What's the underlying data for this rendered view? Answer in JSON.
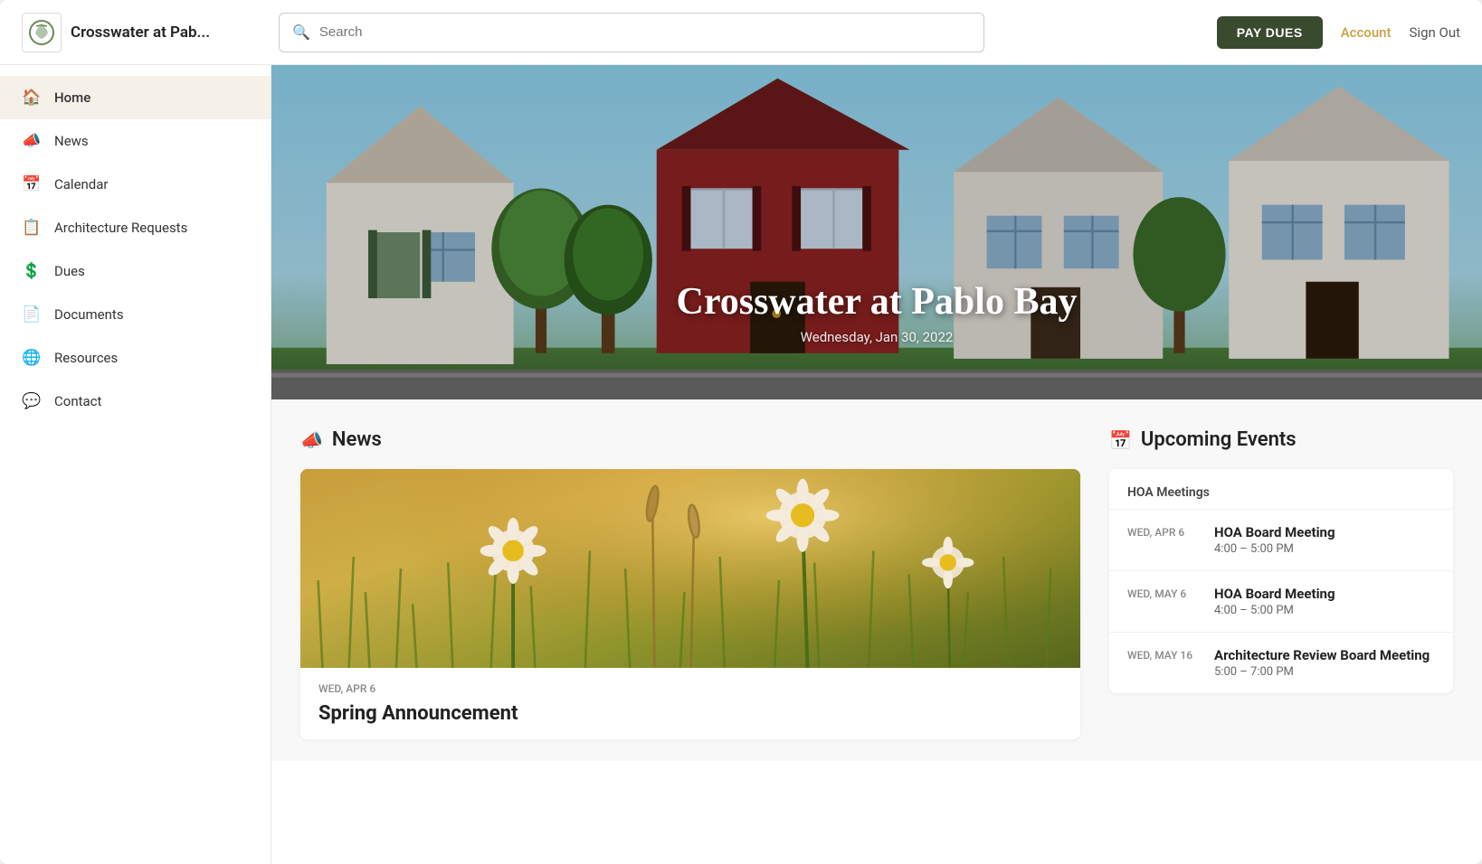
{
  "header": {
    "logo_text": "Crosswater at Pab...",
    "search_placeholder": "Search",
    "pay_dues_label": "PAY DUES",
    "account_label": "Account",
    "signout_label": "Sign Out"
  },
  "sidebar": {
    "items": [
      {
        "id": "home",
        "label": "Home",
        "icon": "🏠",
        "active": true
      },
      {
        "id": "news",
        "label": "News",
        "icon": "📣",
        "active": false
      },
      {
        "id": "calendar",
        "label": "Calendar",
        "icon": "📅",
        "active": false
      },
      {
        "id": "architecture-requests",
        "label": "Architecture Requests",
        "icon": "📋",
        "active": false
      },
      {
        "id": "dues",
        "label": "Dues",
        "icon": "💲",
        "active": false
      },
      {
        "id": "documents",
        "label": "Documents",
        "icon": "📄",
        "active": false
      },
      {
        "id": "resources",
        "label": "Resources",
        "icon": "🌐",
        "active": false
      },
      {
        "id": "contact",
        "label": "Contact",
        "icon": "💬",
        "active": false
      }
    ]
  },
  "hero": {
    "title": "Crosswater at Pablo Bay",
    "date": "Wednesday, Jan 30, 2022"
  },
  "news_section": {
    "title": "News",
    "icon": "📣",
    "article": {
      "date": "WED, APR 6",
      "headline": "Spring Announcement"
    }
  },
  "events_section": {
    "title": "Upcoming Events",
    "icon": "📅",
    "group_label": "HOA Meetings",
    "events": [
      {
        "date": "WED, APR 6",
        "name": "HOA Board Meeting",
        "time": "4:00 – 5:00 PM"
      },
      {
        "date": "WED, MAY 6",
        "name": "HOA Board Meeting",
        "time": "4:00 – 5:00 PM"
      },
      {
        "date": "WED, MAY 16",
        "name": "Architecture Review Board Meeting",
        "time": "5:00 – 7:00 PM"
      }
    ]
  }
}
